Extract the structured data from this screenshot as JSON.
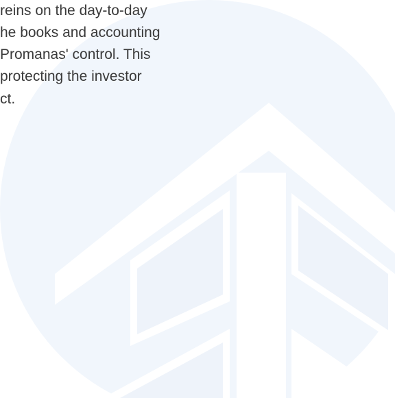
{
  "text_lines": [
    "reins on the day-to-day",
    "he books and accounting",
    "Promanas' control. This",
    "protecting the investor",
    "ct."
  ],
  "colors": {
    "background": "#ffffff",
    "text": "#3a3a3a",
    "watermark_circle": "#f1f6fc",
    "watermark_logo": "#ffffff"
  },
  "icons": {
    "watermark": "company-logo-watermark"
  }
}
